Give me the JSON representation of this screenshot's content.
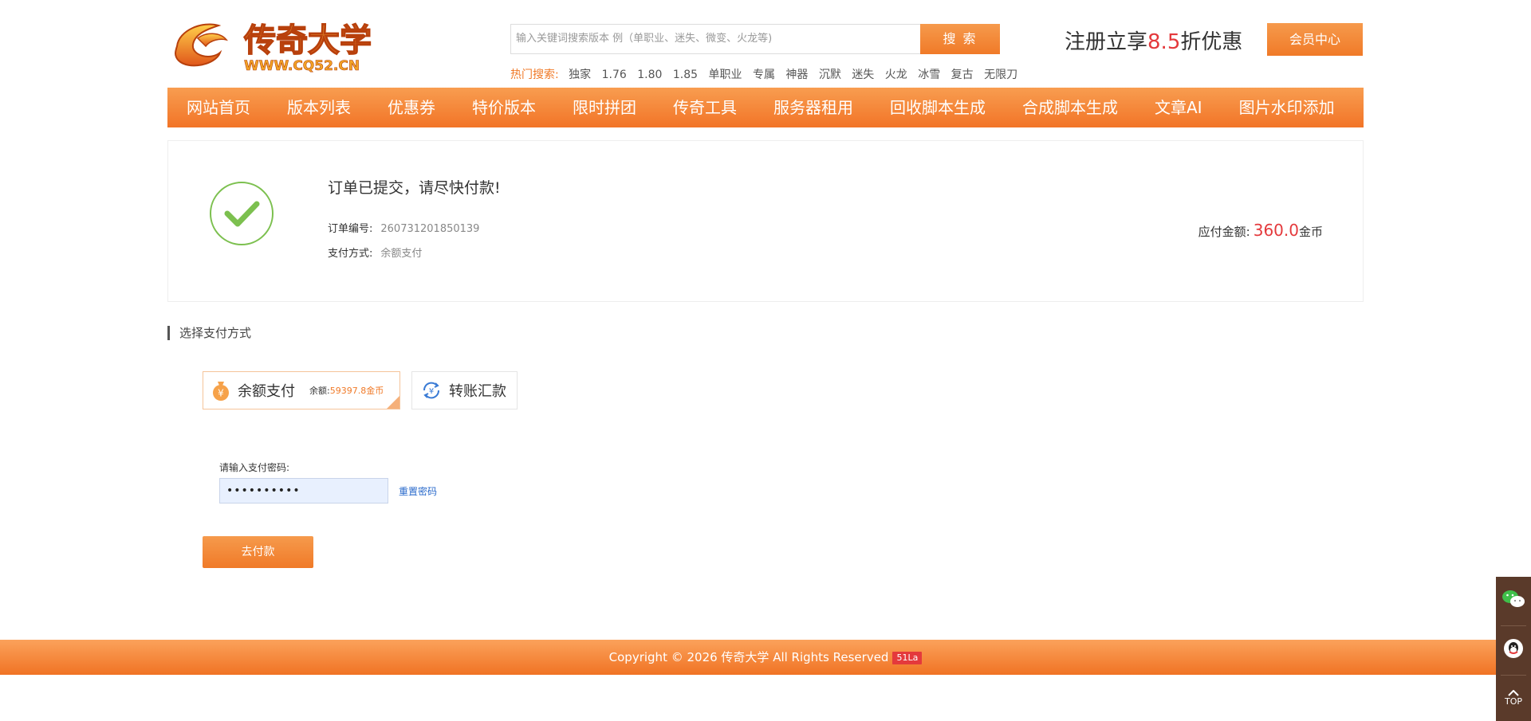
{
  "header": {
    "logo_alt": "传奇大学 WWW.CQ52.CN",
    "search_placeholder": "输入关键词搜索版本 例（单职业、迷失、微变、火龙等)",
    "search_button": "搜 索",
    "hot_label": "热门搜索:",
    "hot_items": [
      "独家",
      "1.76",
      "1.80",
      "1.85",
      "单职业",
      "专属",
      "神器",
      "沉默",
      "迷失",
      "火龙",
      "冰雪",
      "复古",
      "无限刀"
    ],
    "promo_prefix": "注册立享",
    "promo_number": "8.5",
    "promo_suffix": "折优惠",
    "member_button": "会员中心"
  },
  "nav": {
    "items": [
      "网站首页",
      "版本列表",
      "优惠券",
      "特价版本",
      "限时拼团",
      "传奇工具",
      "服务器租用",
      "回收脚本生成",
      "合成脚本生成",
      "文章AI",
      "图片水印添加"
    ]
  },
  "order": {
    "title": "订单已提交，请尽快付款!",
    "number_label": "订单编号:",
    "number_value": "260731201850139",
    "method_label": "支付方式:",
    "method_value": "余额支付",
    "amount_label": "应付金额:",
    "amount_value": "360.0",
    "amount_unit": "金币"
  },
  "payment": {
    "section_title": "选择支付方式",
    "balance_option": "余额支付",
    "balance_label": "余额:",
    "balance_value": "59397.8金币",
    "transfer_option": "转账汇款",
    "password_label": "请输入支付密码:",
    "password_value": "••••••••••",
    "reset_link": "重置密码",
    "pay_button": "去付款"
  },
  "footer": {
    "copyright": "Copyright © 2026 传奇大学 All Rights Reserved",
    "badge": "51La"
  },
  "side": {
    "top_label": "TOP"
  },
  "colors": {
    "accent": "#f07a28",
    "price_red": "#e4393c",
    "success_green": "#7cc04f",
    "link_blue": "#2a6acb"
  }
}
